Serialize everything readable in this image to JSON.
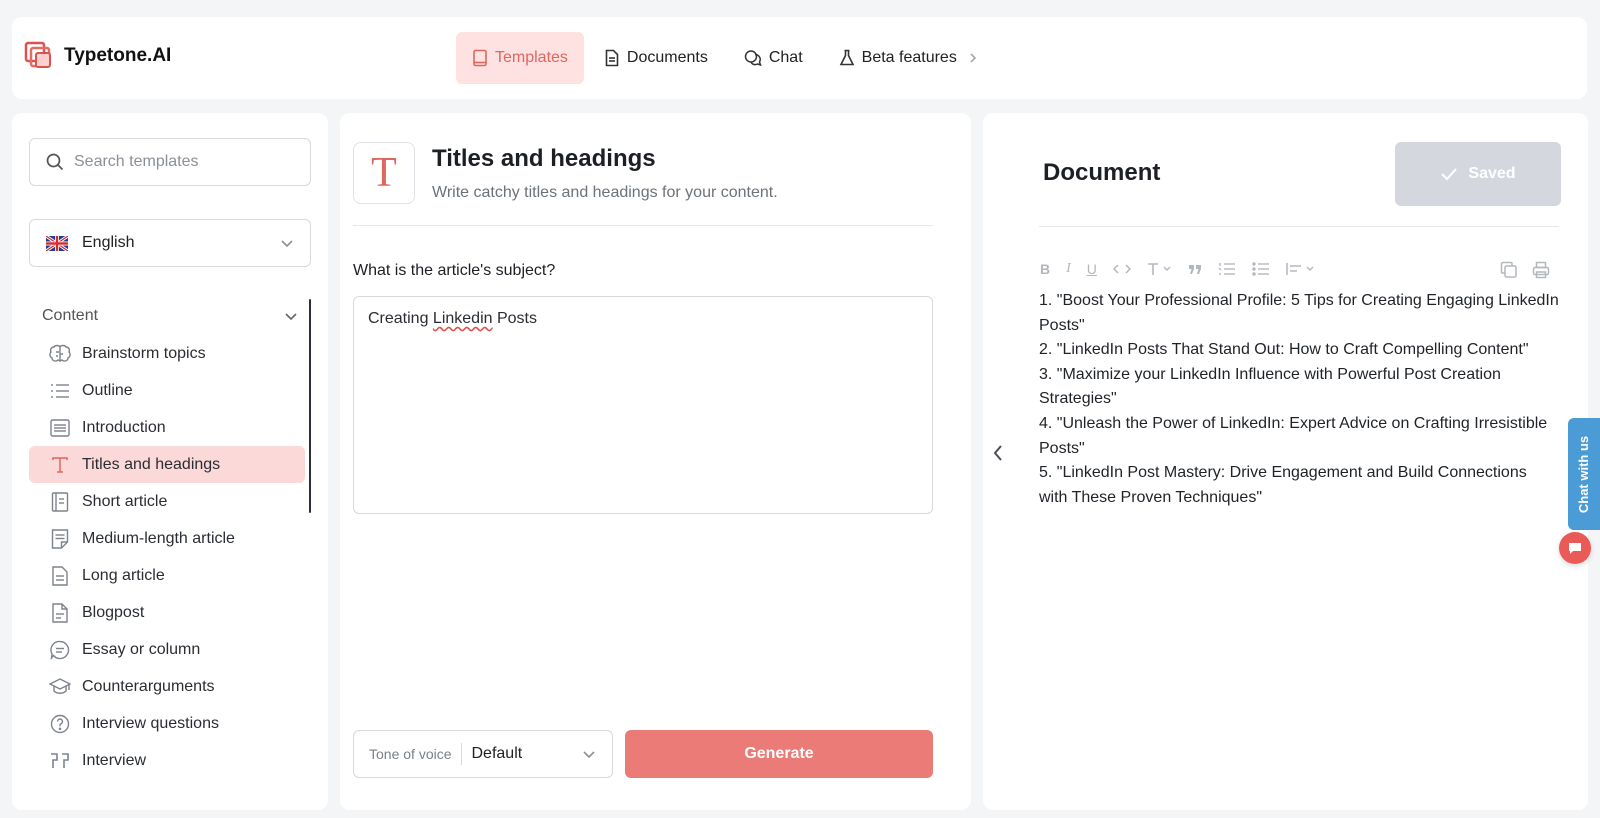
{
  "app": {
    "name": "Typetone.AI"
  },
  "nav": {
    "items": [
      {
        "label": "Templates"
      },
      {
        "label": "Documents"
      },
      {
        "label": "Chat"
      },
      {
        "label": "Beta features"
      }
    ]
  },
  "sidebar": {
    "search_placeholder": "Search templates",
    "language": "English",
    "category": "Content",
    "templates": [
      {
        "label": "Brainstorm topics",
        "icon": "brain-icon"
      },
      {
        "label": "Outline",
        "icon": "list-icon"
      },
      {
        "label": "Introduction",
        "icon": "text-block-icon"
      },
      {
        "label": "Titles and headings",
        "icon": "title-t-icon"
      },
      {
        "label": "Short article",
        "icon": "short-article-icon"
      },
      {
        "label": "Medium-length article",
        "icon": "medium-article-icon"
      },
      {
        "label": "Long article",
        "icon": "long-article-icon"
      },
      {
        "label": "Blogpost",
        "icon": "blogpost-icon"
      },
      {
        "label": "Essay or column",
        "icon": "essay-icon"
      },
      {
        "label": "Counterarguments",
        "icon": "graduation-cap-icon"
      },
      {
        "label": "Interview questions",
        "icon": "question-icon"
      },
      {
        "label": "Interview",
        "icon": "quote-icon"
      }
    ]
  },
  "template": {
    "icon_letter": "T",
    "title": "Titles and headings",
    "subtitle": "Write catchy titles and headings for your content.",
    "question": "What is the article's subject?",
    "subject_before": "Creating ",
    "subject_misspelled": "Linkedin",
    "subject_after": " Posts",
    "tone_label": "Tone of voice",
    "tone_value": "Default",
    "generate_label": "Generate"
  },
  "document": {
    "title": "Document",
    "saved_label": "Saved",
    "lines": [
      "1. \"Boost Your Professional Profile: 5 Tips for Creating Engaging LinkedIn Posts\"",
      "2. \"LinkedIn Posts That Stand Out: How to Craft Compelling Content\"",
      "3. \"Maximize your LinkedIn Influence with Powerful Post Creation Strategies\"",
      "4. \"Unleash the Power of LinkedIn: Expert Advice on Crafting Irresistible Posts\"",
      "5. \"LinkedIn Post Mastery: Drive Engagement and Build Connections with These Proven Techniques\""
    ]
  },
  "chat_widget": {
    "label": "Chat with us"
  },
  "colors": {
    "accent": "#e0655f",
    "accent_light": "#fde2e1",
    "generate": "#ea7b76",
    "chat_tab": "#4a9bd6"
  }
}
